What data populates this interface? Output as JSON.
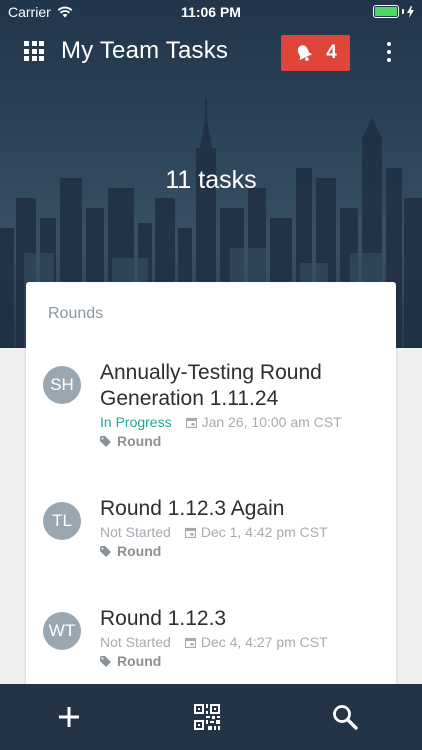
{
  "status_bar": {
    "carrier": "Carrier",
    "time": "11:06 PM",
    "battery_level": 1.0,
    "battery_color": "#4cd964"
  },
  "app_bar": {
    "menu_icon": "grid-icon",
    "title": "My Team Tasks",
    "notification_icon": "bell-icon",
    "notification_count": "4",
    "notification_color": "#e0453a",
    "more_icon": "more-vertical-icon"
  },
  "hero": {
    "task_count": "11 tasks"
  },
  "card": {
    "header": "Rounds",
    "tasks": [
      {
        "initials": "SH",
        "title": "Annually-Testing Round Generation 1.11.24",
        "status": "In Progress",
        "date": "Jan 26, 10:00 am CST",
        "tag": "Round"
      },
      {
        "initials": "TL",
        "title": "Round 1.12.3 Again",
        "status": "Not Started",
        "date": "Dec 1, 4:42 pm CST",
        "tag": "Round"
      },
      {
        "initials": "WT",
        "title": "Round 1.12.3",
        "status": "Not Started",
        "date": "Dec 4, 4:27 pm CST",
        "tag": "Round"
      }
    ]
  },
  "bottom_bar": {
    "add_icon": "plus-icon",
    "scan_icon": "qr-code-icon",
    "search_icon": "search-icon"
  },
  "colors": {
    "header_bg": "#22354a",
    "bottom_bar_bg": "#233446",
    "in_progress": "#26a69a",
    "muted": "#a4abb1"
  }
}
